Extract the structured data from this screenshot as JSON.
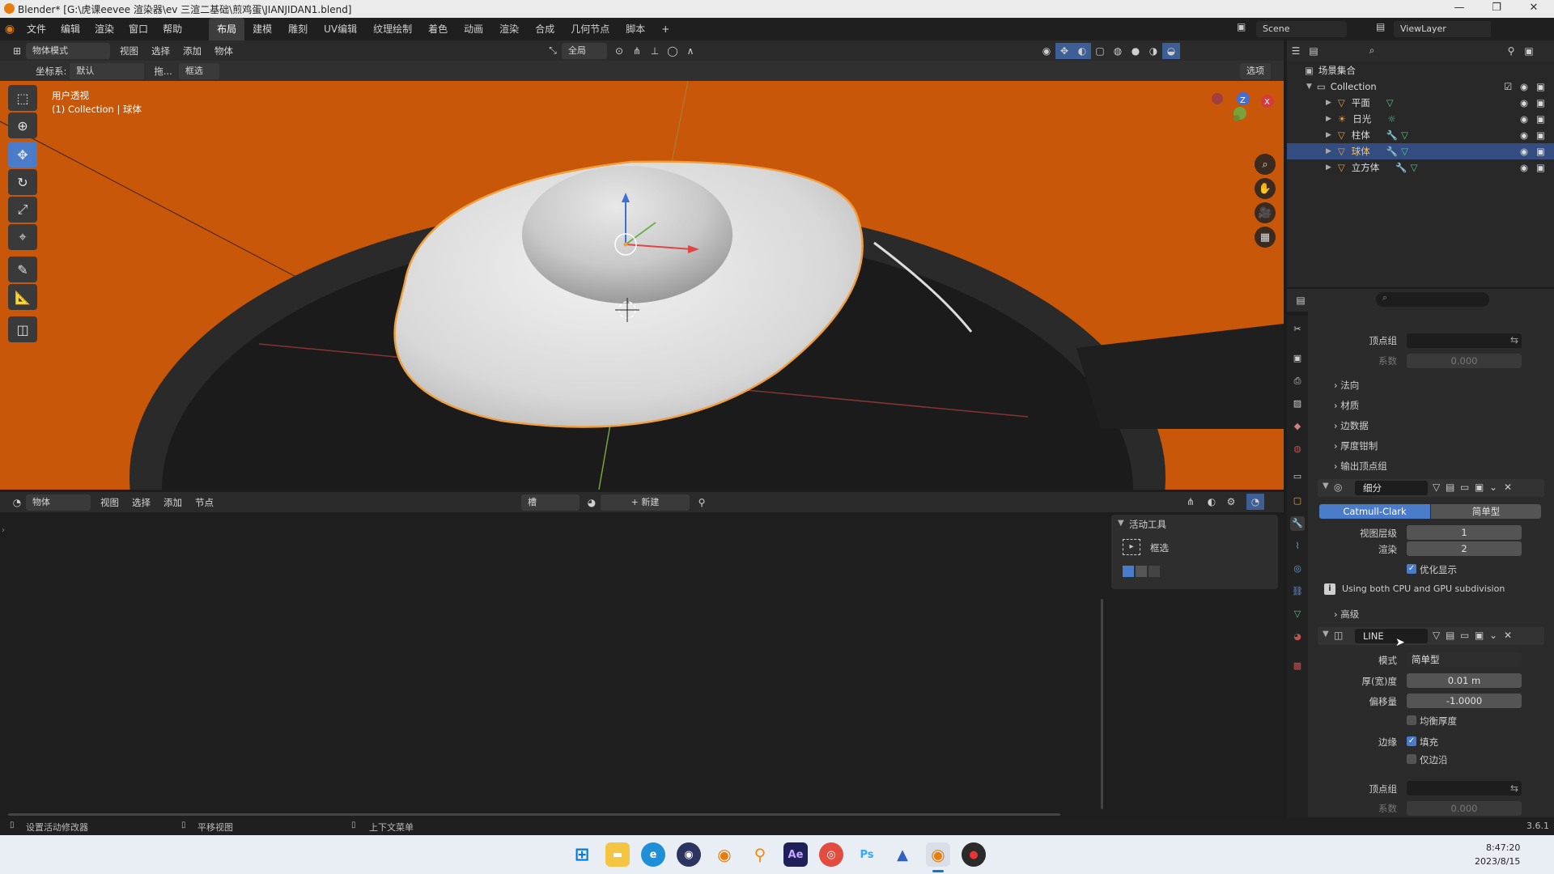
{
  "window": {
    "title": "Blender* [G:\\虎课eevee 渲染器\\ev 三渲二基础\\煎鸡蛋\\JIANJIDAN1.blend]",
    "controls": [
      "—",
      "❐",
      "✕"
    ]
  },
  "menu": [
    "文件",
    "编辑",
    "渲染",
    "窗口",
    "帮助"
  ],
  "workspaces": [
    "布局",
    "建模",
    "雕刻",
    "UV编辑",
    "纹理绘制",
    "着色",
    "动画",
    "渲染",
    "合成",
    "几何节点",
    "脚本"
  ],
  "workspace_add": "+",
  "scene": {
    "scene_name": "Scene",
    "view_layer": "ViewLayer"
  },
  "viewport_header": {
    "mode": "物体模式",
    "menus": [
      "视图",
      "选择",
      "添加",
      "物体"
    ],
    "transform_orientation": "全局"
  },
  "tool_header": {
    "coord_label": "坐标系:",
    "coord_value": "默认",
    "drag_label": "拖...",
    "select_mode": "框选",
    "options": "选项"
  },
  "viewport": {
    "view_name": "用户透视",
    "view_info": "(1) Collection | 球体",
    "gizmo_axes": [
      "Z",
      "X"
    ],
    "colors": {
      "background": "#c8570a",
      "plate": "#2a2a2a",
      "egg_white": "#e4e4e4",
      "selection": "#f0a040"
    }
  },
  "outliner": {
    "root": "场景集合",
    "collection": "Collection",
    "items": [
      {
        "name": "平面",
        "selected": false
      },
      {
        "name": "日光",
        "selected": false
      },
      {
        "name": "柱体",
        "selected": false
      },
      {
        "name": "球体",
        "selected": true
      },
      {
        "name": "立方体",
        "selected": false
      }
    ]
  },
  "properties": {
    "top_vertex_group_label": "顶点组",
    "top_factor_label": "系数",
    "top_factor_value": "0.000",
    "collapsed_sections": [
      "法向",
      "材质",
      "边数据",
      "厚度钳制",
      "输出顶点组"
    ],
    "subdivision": {
      "name": "细分",
      "tabs": [
        "Catmull-Clark",
        "简单型"
      ],
      "viewport_levels_label": "视图层级",
      "viewport_levels": "1",
      "render_label": "渲染",
      "render": "2",
      "optimal_display": "优化显示",
      "info": "Using both CPU and GPU subdivision",
      "advanced": "高级"
    },
    "solidify": {
      "name": "LINE",
      "mode_label": "模式",
      "mode": "简单型",
      "thickness_label": "厚(宽)度",
      "thickness": "0.01 m",
      "offset_label": "偏移量",
      "offset": "-1.0000",
      "even_thickness": "均衡厚度",
      "rim_label": "边缘",
      "fill": "填充",
      "rim_only": "仅边沿",
      "vertex_group_label": "顶点组",
      "factor_label": "系数",
      "factor": "0.000"
    }
  },
  "shader_header": {
    "object": "物体",
    "menus": [
      "视图",
      "选择",
      "添加",
      "节点"
    ],
    "slot": "槽",
    "new": "新建"
  },
  "active_tool": {
    "panel": "活动工具",
    "tool": "框选"
  },
  "status": {
    "left": "设置活动修改器",
    "middle": "平移视图",
    "right": "上下文菜单",
    "version": "3.6.1"
  },
  "taskbar": {
    "time": "8:47:20",
    "date": "2023/8/15",
    "icons": [
      "start",
      "explorer",
      "edge",
      "app-blue",
      "blender",
      "search",
      "after-effects",
      "chrome",
      "photoshop",
      "app-mountain",
      "blender-active",
      "app-red"
    ]
  }
}
